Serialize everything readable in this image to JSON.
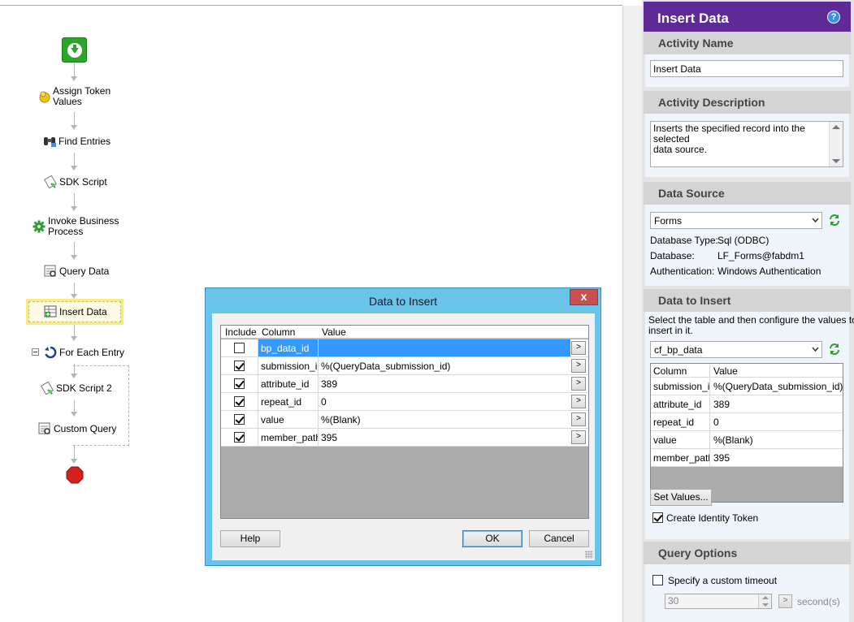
{
  "workflow": {
    "nodes": [
      {
        "label": "Assign Token Values",
        "icon": "token-icon"
      },
      {
        "label": "Find Entries",
        "icon": "binoculars-icon"
      },
      {
        "label": "SDK Script",
        "icon": "script-icon"
      },
      {
        "label": "Invoke Business Process",
        "icon": "gear-icon"
      },
      {
        "label": "Query Data",
        "icon": "query-icon"
      },
      {
        "label": "Insert Data",
        "icon": "insert-icon"
      },
      {
        "label": "For Each Entry",
        "icon": "loop-icon"
      },
      {
        "label": "SDK Script 2",
        "icon": "script-icon"
      },
      {
        "label": "Custom Query",
        "icon": "query-icon"
      }
    ],
    "assign_line1": "Assign Token",
    "assign_line2": "Values",
    "invoke_line1": "Invoke Business",
    "invoke_line2": "Process"
  },
  "dialog": {
    "title": "Data to Insert",
    "close_label": "x",
    "columns": {
      "include": "Include",
      "column": "Column",
      "value": "Value"
    },
    "rows": [
      {
        "include": false,
        "column": "bp_data_id",
        "value": "",
        "selected": true
      },
      {
        "include": true,
        "column": "submission_id",
        "value": "%(QueryData_submission_id)"
      },
      {
        "include": true,
        "column": "attribute_id",
        "value": "389"
      },
      {
        "include": true,
        "column": "repeat_id",
        "value": "0"
      },
      {
        "include": true,
        "column": "value",
        "value": "%(Blank)"
      },
      {
        "include": true,
        "column": "member_path",
        "value": "395"
      }
    ],
    "row_button": ">",
    "help_label": "Help",
    "ok_label": "OK",
    "cancel_label": "Cancel"
  },
  "panel": {
    "title": "Insert Data",
    "help_icon": "?",
    "activity_name": {
      "heading": "Activity Name",
      "value": "Insert Data"
    },
    "activity_description": {
      "heading": "Activity Description",
      "line1": "Inserts the specified record into the selected",
      "line2": "data source."
    },
    "data_source": {
      "heading": "Data Source",
      "selected": "Forms",
      "db_type_label": "Database Type:",
      "db_type_value": "Sql (ODBC)",
      "db_label": "Database:",
      "db_value": "LF_Forms@fabdm1",
      "auth_label": "Authentication:",
      "auth_value": "Windows Authentication"
    },
    "data_to_insert": {
      "heading": "Data to Insert",
      "hint_line1": "Select the table and then configure the values to",
      "hint_line2": "insert in it.",
      "table": "cf_bp_data",
      "col_header": "Column",
      "val_header": "Value",
      "rows": [
        {
          "column": "submission_id",
          "value": "%(QueryData_submission_id)"
        },
        {
          "column": "attribute_id",
          "value": "389"
        },
        {
          "column": "repeat_id",
          "value": "0"
        },
        {
          "column": "value",
          "value": "%(Blank)"
        },
        {
          "column": "member_path",
          "value": "395"
        }
      ],
      "set_values_label": "Set Values...",
      "identity_label": "Create Identity Token",
      "identity_checked": true
    },
    "query_options": {
      "heading": "Query Options",
      "timeout_label": "Specify a custom timeout",
      "timeout_value": "30",
      "unit_button": ">",
      "unit_label": "second(s)"
    }
  }
}
